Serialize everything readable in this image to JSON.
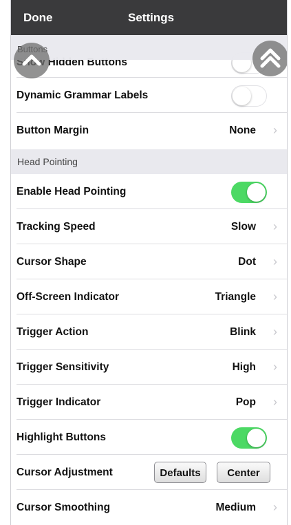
{
  "navbar": {
    "done_label": "Done",
    "title": "Settings"
  },
  "sections": {
    "buttons": {
      "header": "Buttons"
    },
    "head_pointing": {
      "header": "Head Pointing"
    }
  },
  "rows": {
    "show_hidden_buttons": {
      "label": "Show Hidden Buttons",
      "toggle": "off"
    },
    "dynamic_grammar_labels": {
      "label": "Dynamic Grammar Labels",
      "toggle": "off"
    },
    "button_margin": {
      "label": "Button Margin",
      "value": "None"
    },
    "enable_head_pointing": {
      "label": "Enable Head Pointing",
      "toggle": "on"
    },
    "tracking_speed": {
      "label": "Tracking Speed",
      "value": "Slow"
    },
    "cursor_shape": {
      "label": "Cursor Shape",
      "value": "Dot"
    },
    "off_screen_indicator": {
      "label": "Off-Screen Indicator",
      "value": "Triangle"
    },
    "trigger_action": {
      "label": "Trigger Action",
      "value": "Blink"
    },
    "trigger_sensitivity": {
      "label": "Trigger Sensitivity",
      "value": "High"
    },
    "trigger_indicator": {
      "label": "Trigger Indicator",
      "value": "Pop"
    },
    "highlight_buttons": {
      "label": "Highlight Buttons",
      "toggle": "on"
    },
    "cursor_adjustment": {
      "label": "Cursor Adjustment",
      "defaults_label": "Defaults",
      "center_label": "Center"
    },
    "cursor_smoothing": {
      "label": "Cursor Smoothing",
      "value": "Medium"
    }
  },
  "icons": {
    "scroll_up_one": "chevron-up-icon",
    "scroll_to_top": "double-chevron-up-icon",
    "disclosure": "chevron-right-icon"
  },
  "colors": {
    "toggle_on": "#4cd964",
    "navbar": "#3a3a3c",
    "section_bg": "#e9e9ee"
  }
}
